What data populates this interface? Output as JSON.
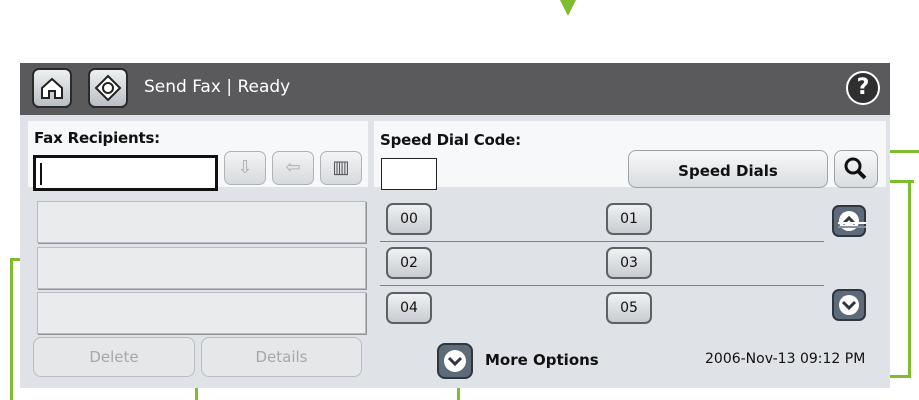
{
  "title_bar": {
    "title": "Send Fax | Ready",
    "home_icon": "home-icon",
    "app_icon": "send-fax-icon",
    "help_glyph": "?"
  },
  "recipients": {
    "label": "Fax Recipients:",
    "input_value": "",
    "rows": [
      "",
      "",
      ""
    ],
    "delete_label": "Delete",
    "details_label": "Details"
  },
  "speed_dial": {
    "label": "Speed Dial Code:",
    "input_value": "",
    "button_label": "Speed Dials",
    "codes": [
      "00",
      "01",
      "02",
      "03",
      "04",
      "05"
    ]
  },
  "footer": {
    "more_options_label": "More Options",
    "date": "2006-Nov-13",
    "time": "09:12 PM"
  },
  "colors": {
    "callout": "#7dbd2e",
    "title_bar": "#5a5a5c",
    "panel": "#dfe2e6",
    "scroll_button": "#5d6a7a"
  }
}
